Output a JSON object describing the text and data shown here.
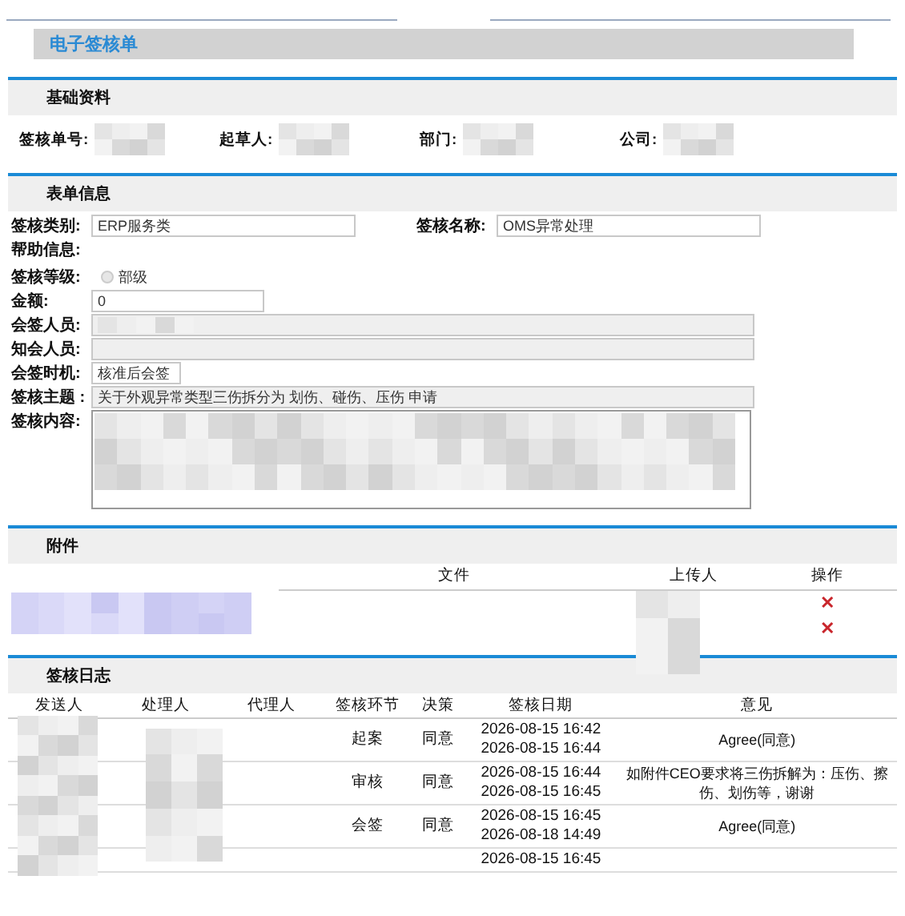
{
  "page_title": "电子签核单",
  "basic_info": {
    "title": "基础资料",
    "fields": [
      {
        "label": "签核单号:"
      },
      {
        "label": "起草人:"
      },
      {
        "label": "部门:"
      },
      {
        "label": "公司:"
      }
    ]
  },
  "form_info": {
    "title": "表单信息",
    "rows": [
      [
        {
          "kind": "input",
          "label": "签核类别:",
          "value": "ERP服务类"
        },
        {
          "kind": "input",
          "label": "签核名称:",
          "value": "OMS异常处理"
        }
      ],
      [
        {
          "kind": "label",
          "label": "帮助信息:"
        }
      ],
      [
        {
          "kind": "radio",
          "label": "签核等级:",
          "options": [
            {
              "label": "部级",
              "selected": false
            }
          ]
        }
      ],
      [
        {
          "kind": "small-input",
          "label": "金额:",
          "value": "0"
        }
      ],
      [
        {
          "kind": "readonly",
          "label": "会签人员:",
          "redacted": true
        }
      ],
      [
        {
          "kind": "readonly",
          "label": "知会人员:",
          "redacted": false
        }
      ],
      [
        {
          "kind": "tiny-input",
          "label": "会签时机:",
          "value": "核准后会签"
        }
      ],
      [
        {
          "kind": "readonly",
          "label": "签核主题 :",
          "value": "关于外观异常类型三伤拆分为 划伤、碰伤、压伤 申请"
        }
      ],
      [
        {
          "kind": "textarea",
          "label": "签核内容:",
          "redacted": true
        }
      ]
    ]
  },
  "attachments": {
    "title": "附件",
    "columns": [
      "文件",
      "上传人",
      "操作"
    ],
    "rows": [
      {
        "action": "✕"
      },
      {
        "action": "✕"
      }
    ]
  },
  "log": {
    "title": "签核日志",
    "columns": [
      "发送人",
      "处理人",
      "代理人",
      "签核环节",
      "决策",
      "签核日期",
      "意见"
    ],
    "rows": [
      {
        "stage": "起案",
        "decision": "同意",
        "dates": [
          "2026-08-15 16:42",
          "2026-08-15 16:44"
        ],
        "opinion": "Agree(同意)"
      },
      {
        "stage": "审核",
        "decision": "同意",
        "dates": [
          "2026-08-15 16:44",
          "2026-08-15 16:45"
        ],
        "opinion": "如附件CEO要求将三伤拆解为：压伤、擦伤、划伤等，谢谢"
      },
      {
        "stage": "会签",
        "decision": "同意",
        "dates": [
          "2026-08-15 16:45",
          "2026-08-18 14:49"
        ],
        "opinion": "Agree(同意)"
      },
      {
        "dates": [
          "2026-08-15 16:45"
        ]
      }
    ]
  }
}
